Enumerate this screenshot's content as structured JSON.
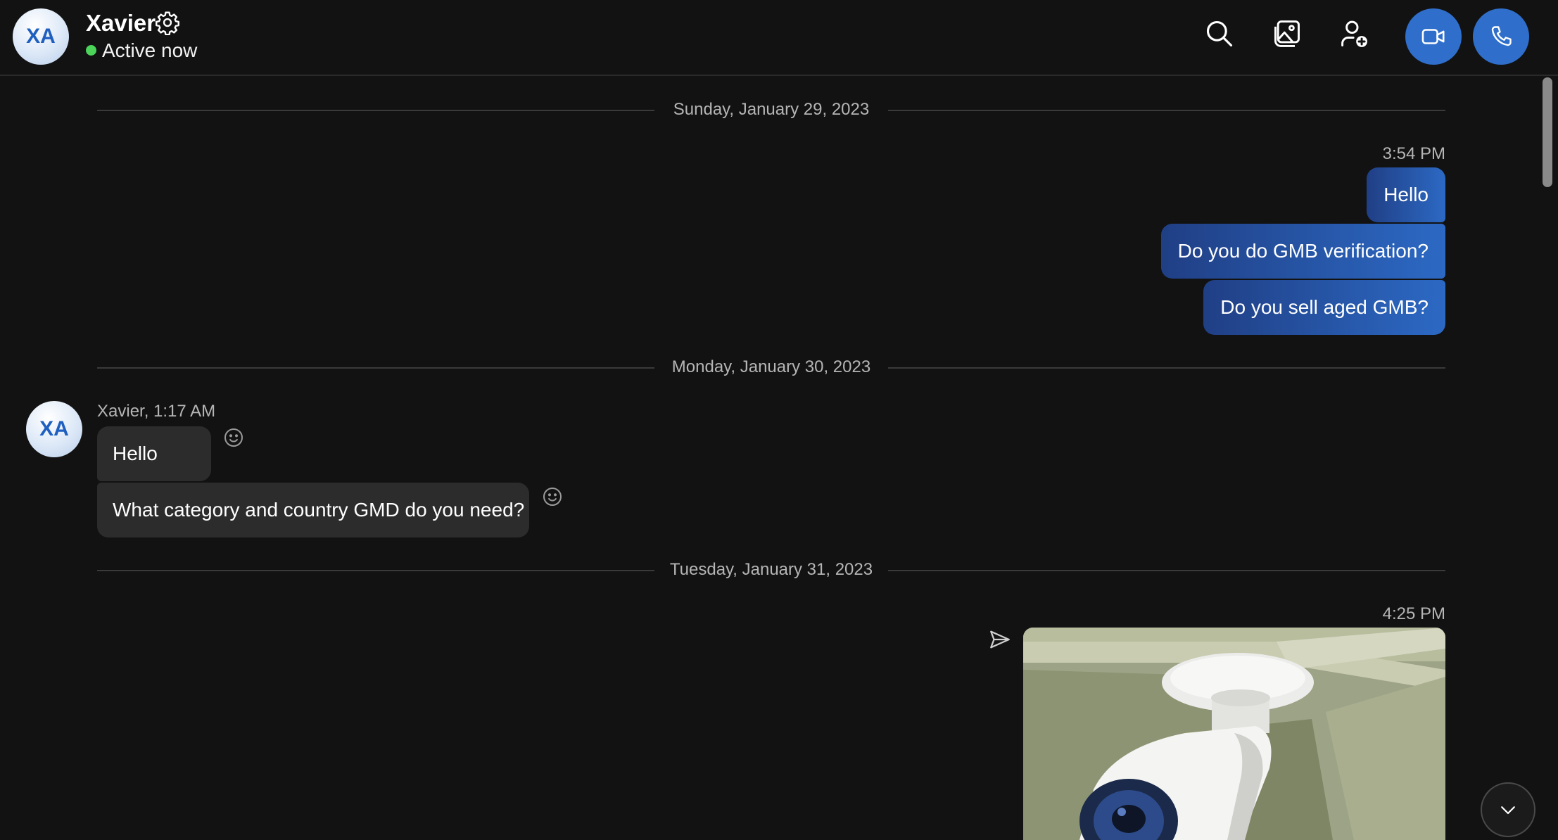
{
  "header": {
    "avatar_initials": "XA",
    "contact_name": "Xavier",
    "status_text": "Active now",
    "status_color": "#4cd35a",
    "icons": [
      "search-icon",
      "gallery-icon",
      "add-person-icon",
      "video-call-icon",
      "phone-call-icon"
    ],
    "call_button_color": "#2f6fcb"
  },
  "conversation": {
    "days": [
      {
        "date_label": "Sunday, January 29, 2023",
        "groups": [
          {
            "direction": "outgoing",
            "time": "3:54 PM",
            "messages": [
              "Hello",
              "Do you do GMB verification?",
              "Do you sell aged GMB?"
            ]
          }
        ]
      },
      {
        "date_label": "Monday, January 30, 2023",
        "groups": [
          {
            "direction": "incoming",
            "sender_avatar": "XA",
            "sender_line": "Xavier, 1:17 AM",
            "messages": [
              "Hello",
              "What category and country GMD do you need?"
            ]
          }
        ]
      },
      {
        "date_label": "Tuesday, January 31, 2023",
        "groups": [
          {
            "direction": "outgoing",
            "time": "4:25 PM",
            "attachment": "image",
            "status_icon": "sent-icon"
          }
        ]
      }
    ]
  },
  "colors": {
    "background": "#121212",
    "outgoing_bubble_start": "#203f85",
    "outgoing_bubble_end": "#2c69c4",
    "incoming_bubble": "#2c2c2c"
  }
}
